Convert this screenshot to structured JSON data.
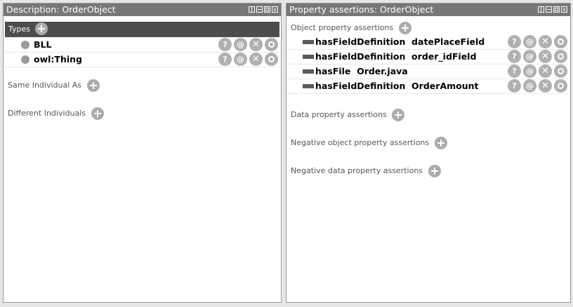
{
  "left_panel": {
    "title": "Description: OrderObject",
    "types_label": "Types",
    "types": [
      {
        "label": "BLL"
      },
      {
        "label": "owl:Thing"
      }
    ],
    "same_individual_label": "Same Individual As",
    "different_individuals_label": "Different Individuals"
  },
  "right_panel": {
    "title": "Property assertions: OrderObject",
    "object_props_label": "Object property assertions",
    "object_props": [
      {
        "label": "hasFieldDefinition  datePlaceField"
      },
      {
        "label": "hasFieldDefinition  order_idField"
      },
      {
        "label": "hasFile  Order.java"
      },
      {
        "label": "hasFieldDefinition  OrderAmount"
      }
    ],
    "data_props_label": "Data property assertions",
    "neg_object_props_label": "Negative object property assertions",
    "neg_data_props_label": "Negative data property assertions"
  },
  "row_actions": {
    "explain": "?",
    "annotate": "@",
    "delete": "✕"
  },
  "window_controls": {
    "close": "x"
  },
  "icons": {
    "add": "plus-circle-icon",
    "explain": "question-icon",
    "annotate": "at-icon",
    "delete": "x-icon",
    "edit": "circle-o-icon",
    "class": "class-circle-icon",
    "object_property": "object-property-bar-icon"
  },
  "colors": {
    "titlebar": "#777777",
    "types_header": "#4d4d4d",
    "button": "#b0b0b0",
    "class_dot": "#9a9a9a",
    "property_bar": "#5a5a5a"
  }
}
